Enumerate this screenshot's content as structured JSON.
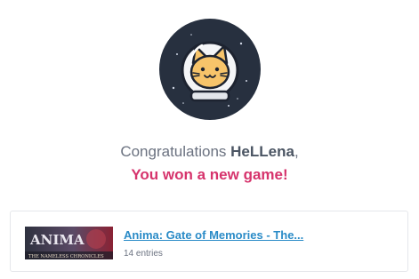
{
  "winner": {
    "prefix": "Congratulations ",
    "username": "HeLLena",
    "suffix": ",",
    "message": "You won a new game!"
  },
  "avatar": {
    "icon": "astronaut-cat-icon"
  },
  "prize": {
    "title": "Anima: Gate of Memories - The...",
    "entries": "14 entries",
    "thumbnail": {
      "logo_text": "ANIMA",
      "caption": "THE NAMELESS CHRONICLES"
    }
  },
  "colors": {
    "accent_pink": "#d6336c",
    "link_blue": "#2a8bc7",
    "avatar_bg": "#27303f"
  }
}
